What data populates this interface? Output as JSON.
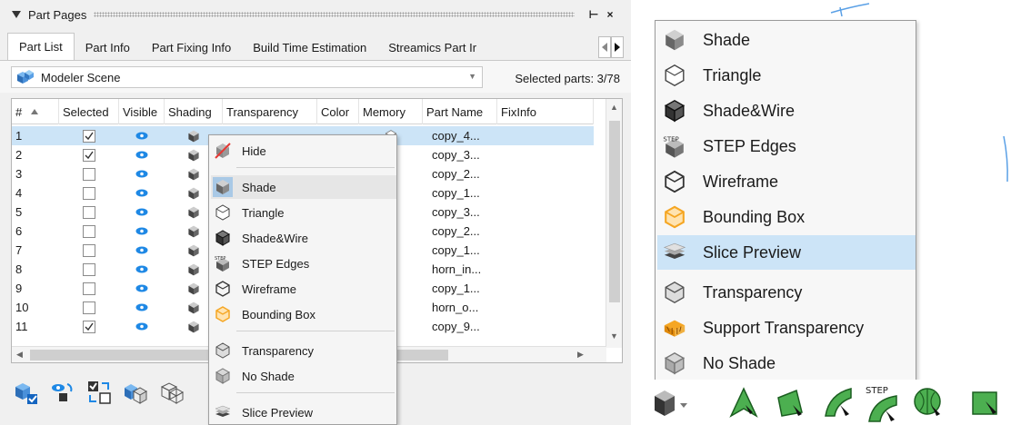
{
  "panel": {
    "title": "Part Pages",
    "pin_glyph": "⊢",
    "close_glyph": "×"
  },
  "tabs": [
    {
      "label": "Part List",
      "active": true
    },
    {
      "label": "Part Info"
    },
    {
      "label": "Part Fixing Info"
    },
    {
      "label": "Build Time Estimation"
    },
    {
      "label": "Streamics Part Ir"
    }
  ],
  "scene": {
    "label": "Modeler Scene",
    "selected_parts": "Selected parts: 3/78"
  },
  "table": {
    "headers": [
      "#",
      "Selected",
      "Visible",
      "Shading",
      "Transparency",
      "Color",
      "Memory",
      "Part Name",
      "FixInfo"
    ],
    "rows": [
      {
        "num": "1",
        "checked": true,
        "name": "copy_4..."
      },
      {
        "num": "2",
        "checked": true,
        "name": "copy_3..."
      },
      {
        "num": "3",
        "checked": false,
        "name": "copy_2..."
      },
      {
        "num": "4",
        "checked": false,
        "name": "copy_1..."
      },
      {
        "num": "5",
        "checked": false,
        "name": "copy_3..."
      },
      {
        "num": "6",
        "checked": false,
        "name": "copy_2..."
      },
      {
        "num": "7",
        "checked": false,
        "name": "copy_1..."
      },
      {
        "num": "8",
        "checked": false,
        "name": "horn_in..."
      },
      {
        "num": "9",
        "checked": false,
        "name": "copy_1..."
      },
      {
        "num": "10",
        "checked": false,
        "name": "horn_o..."
      },
      {
        "num": "11",
        "checked": true,
        "name": "copy_9..."
      }
    ]
  },
  "context_menu": {
    "items": [
      {
        "label": "Hide",
        "icon": "hide-icon"
      },
      {
        "label": "Shade",
        "icon": "shade-icon"
      },
      {
        "label": "Triangle",
        "icon": "triangle-icon"
      },
      {
        "label": "Shade&Wire",
        "icon": "shade-wire-icon"
      },
      {
        "label": "STEP Edges",
        "icon": "step-edges-icon"
      },
      {
        "label": "Wireframe",
        "icon": "wireframe-icon"
      },
      {
        "label": "Bounding Box",
        "icon": "bounding-box-icon"
      },
      {
        "label": "Transparency",
        "icon": "transparency-icon"
      },
      {
        "label": "No Shade",
        "icon": "no-shade-icon"
      },
      {
        "label": "Slice Preview",
        "icon": "slice-preview-icon"
      }
    ]
  },
  "shading_menu": {
    "items": [
      {
        "label": "Shade",
        "icon": "shade-icon"
      },
      {
        "label": "Triangle",
        "icon": "triangle-icon"
      },
      {
        "label": "Shade&Wire",
        "icon": "shade-wire-icon"
      },
      {
        "label": "STEP Edges",
        "icon": "step-edges-icon"
      },
      {
        "label": "Wireframe",
        "icon": "wireframe-icon"
      },
      {
        "label": "Bounding Box",
        "icon": "bounding-box-icon"
      },
      {
        "label": "Slice Preview",
        "icon": "slice-preview-icon",
        "highlighted": true
      },
      {
        "label": "Transparency",
        "icon": "transparency-icon"
      },
      {
        "label": "Support Transparency",
        "icon": "support-transparency-icon"
      },
      {
        "label": "No Shade",
        "icon": "no-shade-icon"
      }
    ]
  },
  "step_badge": "STEP",
  "colors": {
    "selection": "#cce4f7",
    "accent_blue": "#1e88e5",
    "tool_green": "#4caf50",
    "bbox_orange": "#f5a623"
  }
}
